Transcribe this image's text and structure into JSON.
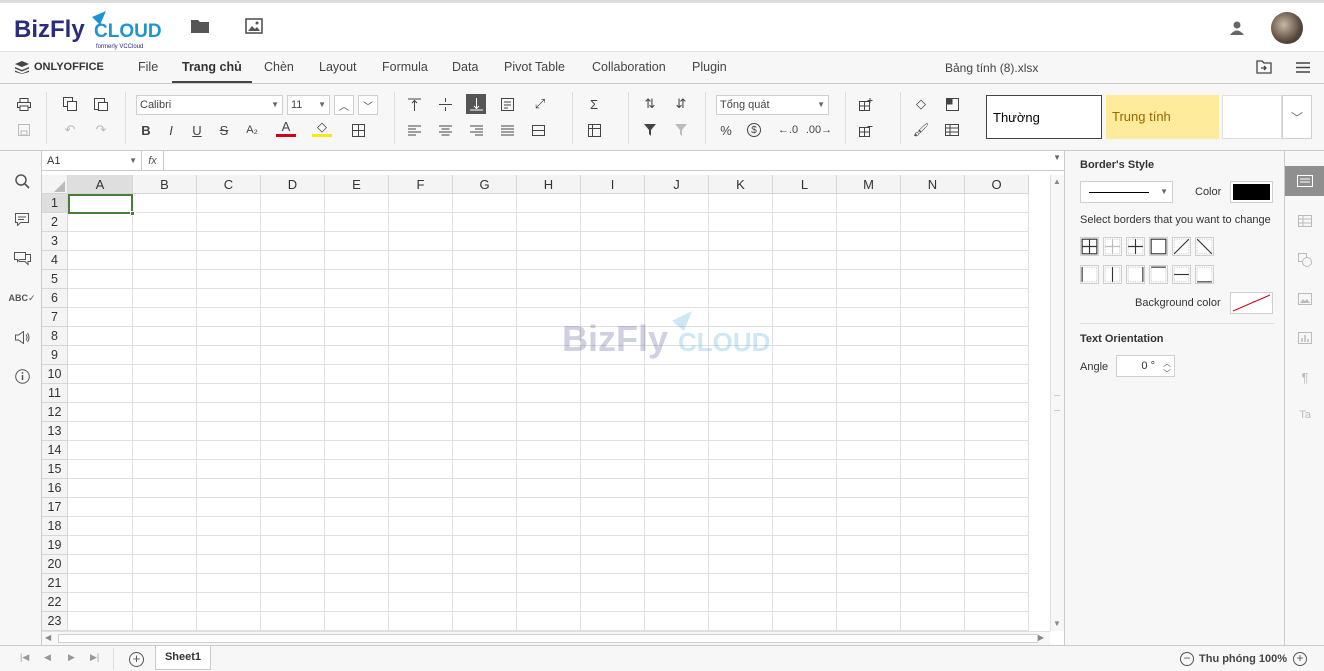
{
  "brand": {
    "name": "BizFly",
    "cloud": "CLOUD",
    "formerly": "formerly VCCloud"
  },
  "app": {
    "name": "ONLYOFFICE",
    "doc_title": "Bảng tính (8).xlsx"
  },
  "tabs": [
    "File",
    "Trang chủ",
    "Chèn",
    "Layout",
    "Formula",
    "Data",
    "Pivot Table",
    "Collaboration",
    "Plugin"
  ],
  "toolbar": {
    "font_name": "Calibri",
    "font_size": "11",
    "number_format": "Tổng quát",
    "style_normal": "Thường",
    "style_neutral": "Trung tính",
    "bold": "B",
    "italic": "I",
    "underline": "U",
    "strike": "S",
    "subscript": "A₂",
    "font_color": "A",
    "percent": "%",
    "currency": "$",
    "sum": "Σ"
  },
  "formula_bar": {
    "cell_ref": "A1",
    "fx": "fx"
  },
  "grid": {
    "columns": [
      "A",
      "B",
      "C",
      "D",
      "E",
      "F",
      "G",
      "H",
      "I",
      "J",
      "K",
      "L",
      "M",
      "N",
      "O"
    ],
    "rows": [
      "1",
      "2",
      "3",
      "4",
      "5",
      "6",
      "7",
      "8",
      "9",
      "10",
      "11",
      "12",
      "13",
      "14",
      "15",
      "16",
      "17",
      "18",
      "19",
      "20",
      "21",
      "22",
      "23"
    ]
  },
  "panel": {
    "border_style": "Border's Style",
    "color": "Color",
    "select_borders": "Select borders that you want to change",
    "background_color": "Background color",
    "text_orientation": "Text Orientation",
    "angle": "Angle",
    "angle_value": "0 °"
  },
  "status": {
    "sheet": "Sheet1",
    "zoom": "Thu phóng 100%"
  },
  "colors": {
    "accent": "#444444",
    "neutral_style": "#ffeb9c",
    "neutral_text": "#9c6500",
    "brand_blue": "#1f94d2",
    "brand_navy": "#2b2c7a"
  }
}
